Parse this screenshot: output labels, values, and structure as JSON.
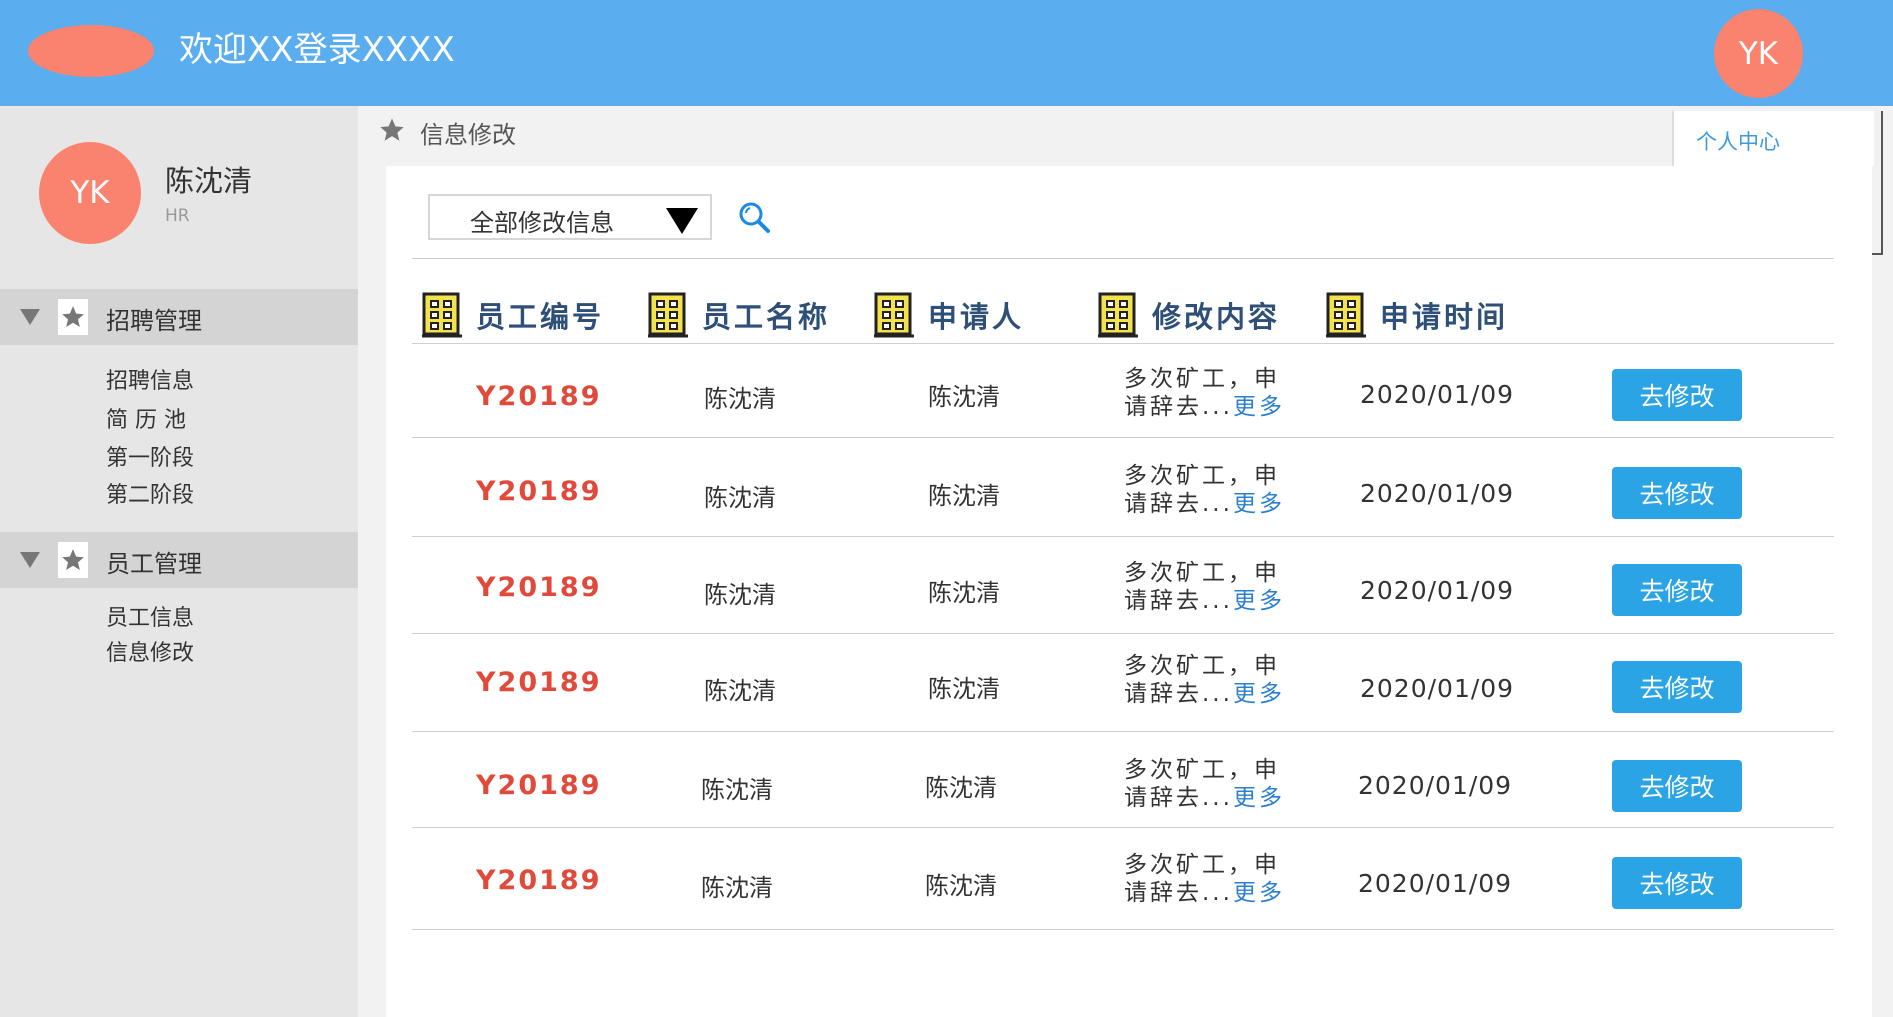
{
  "header": {
    "title": "欢迎XX登录XXXX",
    "avatar_text": "YK"
  },
  "profile": {
    "avatar_text": "YK",
    "name": "陈沈清",
    "role": "HR"
  },
  "sidebar": {
    "groups": [
      {
        "label": "招聘管理",
        "items": [
          "招聘信息",
          "简 历 池",
          "第一阶段",
          "第二阶段"
        ]
      },
      {
        "label": "员工管理",
        "items": [
          "员工信息",
          "信息修改"
        ]
      }
    ]
  },
  "breadcrumb": {
    "label": "信息修改"
  },
  "personal_center": "个人中心",
  "filter": {
    "selected": "全部修改信息"
  },
  "table": {
    "columns": [
      "员工编号",
      "员工名称",
      "申请人",
      "修改内容",
      "申请时间"
    ],
    "rows": [
      {
        "id": "Y20189",
        "name": "陈沈清",
        "applicant": "陈沈清",
        "content_line1": "多次矿工，申",
        "content_line2": "请辞去...",
        "more": "更多",
        "date": "2020/01/09",
        "action": "去修改"
      },
      {
        "id": "Y20189",
        "name": "陈沈清",
        "applicant": "陈沈清",
        "content_line1": "多次矿工，申",
        "content_line2": "请辞去...",
        "more": "更多",
        "date": "2020/01/09",
        "action": "去修改"
      },
      {
        "id": "Y20189",
        "name": "陈沈清",
        "applicant": "陈沈清",
        "content_line1": "多次矿工，申",
        "content_line2": "请辞去...",
        "more": "更多",
        "date": "2020/01/09",
        "action": "去修改"
      },
      {
        "id": "Y20189",
        "name": "陈沈清",
        "applicant": "陈沈清",
        "content_line1": "多次矿工，申",
        "content_line2": "请辞去...",
        "more": "更多",
        "date": "2020/01/09",
        "action": "去修改"
      },
      {
        "id": "Y20189",
        "name": "陈沈清",
        "applicant": "陈沈清",
        "content_line1": "多次矿工，申",
        "content_line2": "请辞去...",
        "more": "更多",
        "date": "2020/01/09",
        "action": "去修改"
      },
      {
        "id": "Y20189",
        "name": "陈沈清",
        "applicant": "陈沈清",
        "content_line1": "多次矿工，申",
        "content_line2": "请辞去...",
        "more": "更多",
        "date": "2020/01/09",
        "action": "去修改"
      }
    ]
  },
  "icons": {
    "column_header": "building-icon",
    "breadcrumb": "star-icon",
    "nav_group": "star-icon",
    "search": "search-icon",
    "dropdown": "caret-down-icon"
  },
  "colors": {
    "header_bg": "#5aadee",
    "avatar_bg": "#f9836f",
    "primary_button": "#2aa4e4",
    "employee_id": "#e04a3a",
    "link": "#2a7fcf",
    "column_header_text": "#2e4f78",
    "building_icon": "#f3e24c"
  }
}
